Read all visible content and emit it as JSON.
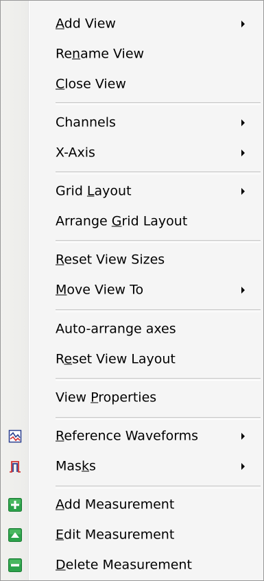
{
  "menu": {
    "items": [
      {
        "pre": "",
        "ul": "A",
        "post": "dd View",
        "submenu": true
      },
      {
        "pre": "Re",
        "ul": "n",
        "post": "ame View",
        "submenu": false
      },
      {
        "pre": "",
        "ul": "C",
        "post": "lose View",
        "submenu": false
      },
      {
        "pre": "Channels",
        "ul": "",
        "post": "",
        "submenu": true
      },
      {
        "pre": "X-Axis",
        "ul": "",
        "post": "",
        "submenu": true
      },
      {
        "pre": "Grid ",
        "ul": "L",
        "post": "ayout",
        "submenu": true
      },
      {
        "pre": "Arrange ",
        "ul": "G",
        "post": "rid Layout",
        "submenu": false
      },
      {
        "pre": "",
        "ul": "R",
        "post": "eset View Sizes",
        "submenu": false
      },
      {
        "pre": "",
        "ul": "M",
        "post": "ove View To",
        "submenu": true
      },
      {
        "pre": "Auto-arrange axes",
        "ul": "",
        "post": "",
        "submenu": false
      },
      {
        "pre": "R",
        "ul": "e",
        "post": "set View Layout",
        "submenu": false
      },
      {
        "pre": "View ",
        "ul": "P",
        "post": "roperties",
        "submenu": false
      },
      {
        "pre": "",
        "ul": "R",
        "post": "eference Waveforms",
        "submenu": true,
        "icon": "reference-waveform-icon"
      },
      {
        "pre": "Mas",
        "ul": "k",
        "post": "s",
        "submenu": true,
        "icon": "mask-icon"
      },
      {
        "pre": "",
        "ul": "A",
        "post": "dd Measurement",
        "submenu": false,
        "icon": "add-measurement-icon"
      },
      {
        "pre": "",
        "ul": "E",
        "post": "dit Measurement",
        "submenu": false,
        "icon": "edit-measurement-icon"
      },
      {
        "pre": "",
        "ul": "D",
        "post": "elete Measurement",
        "submenu": false,
        "icon": "delete-measurement-icon"
      }
    ]
  },
  "colors": {
    "menu_background": "#f5f5f5",
    "icon_green": "#2ca24a",
    "icon_red": "#d03030",
    "icon_navy": "#2a3f8f"
  }
}
